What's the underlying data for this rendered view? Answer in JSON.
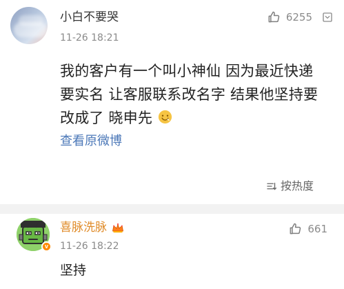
{
  "main_comment": {
    "username": "小白不要哭",
    "time": "11-26 18:21",
    "like_count": "6255",
    "content_lines": [
      "我的客户有一个叫小神仙 因为最近快递",
      "要实名 让客服联系改名字 结果他坚持要",
      "改成了 晓申先"
    ],
    "source_link": "查看原微博",
    "sort_label": "按热度"
  },
  "reply_comment": {
    "username": "喜脉洗脉",
    "time": "11-26 18:22",
    "like_count": "661",
    "content": "坚持",
    "verification_badge": "v"
  },
  "icons": {
    "thumbs_up": "thumbs-up-icon",
    "more": "chevron-down-icon",
    "sort": "sort-lines-icon",
    "emoji": "smiley-face-icon",
    "crown": "crown-icon"
  },
  "colors": {
    "background": "#ffffff",
    "separator": "#f2f2f2",
    "primary_text": "#222222",
    "secondary_text": "#8a8a8a",
    "link": "#4c78b8",
    "reply_username": "#e08c2a",
    "vip_badge": "#ff8a00"
  }
}
